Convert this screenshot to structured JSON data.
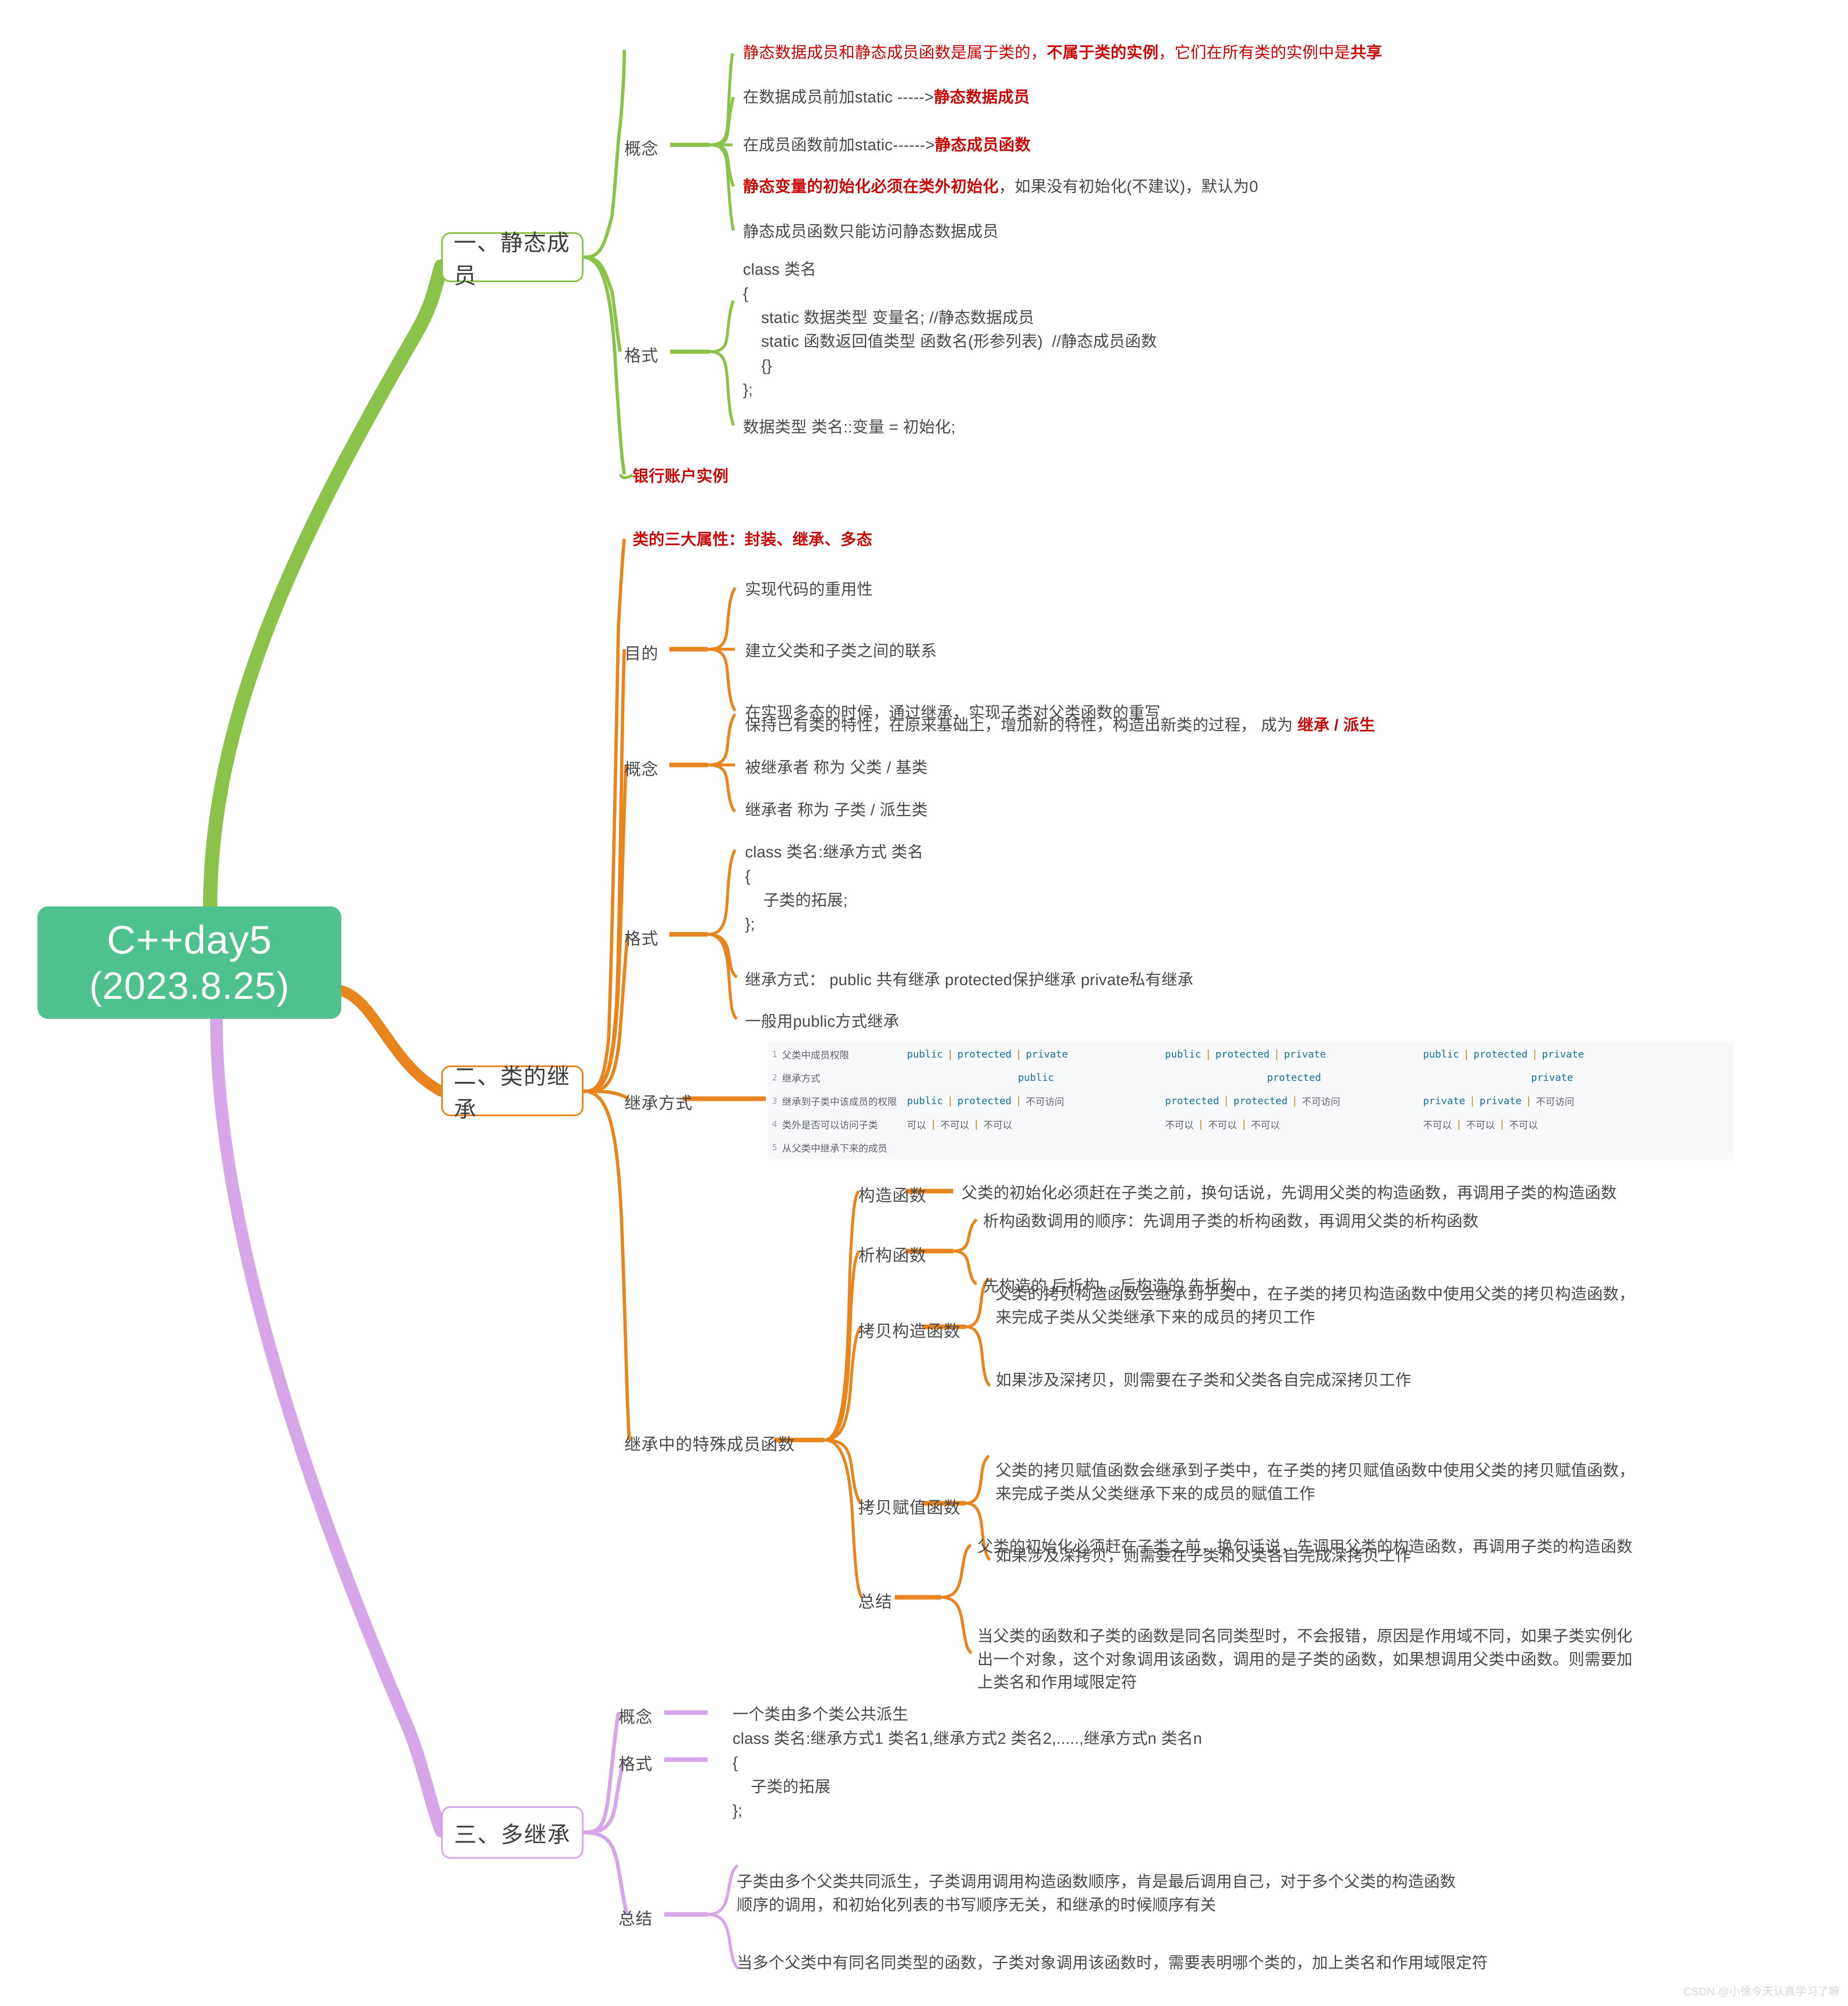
{
  "root": {
    "line1": "C++day5",
    "line2": "(2023.8.25)"
  },
  "colors": {
    "root_bg": "#4ec18e",
    "branch1": "#8bc34a",
    "branch2": "#e8851e",
    "branch3": "#d6a6e8",
    "highlight_red": "#cc0000",
    "text": "#4a4a4a",
    "table_bg": "#f8f9fb",
    "table_keyword": "#1a73a7",
    "table_sep": "#c8860d"
  },
  "branches": [
    {
      "title": "一、静态成员",
      "groups": [
        {
          "label": "概念",
          "items": [
            {
              "parts": [
                {
                  "t": "静态数据成员和静态成员函数是属于类的，",
                  "s": "n"
                },
                {
                  "t": "不属于类的实例",
                  "s": "b"
                },
                {
                  "t": "，它们在所有类的实例中是",
                  "s": "n"
                },
                {
                  "t": "共享",
                  "s": "b"
                }
              ]
            },
            {
              "parts": [
                {
                  "t": "在数据成员前加static ----->",
                  "s": "n"
                },
                {
                  "t": "静态数据成员",
                  "s": "b"
                }
              ]
            },
            {
              "parts": [
                {
                  "t": "在成员函数前加static------>",
                  "s": "n"
                },
                {
                  "t": "静态成员函数",
                  "s": "b"
                }
              ]
            },
            {
              "parts": [
                {
                  "t": "静态变量的初始化必须在类外初始化",
                  "s": "b"
                },
                {
                  "t": "，如果没有初始化(不建议)，默认为0",
                  "s": "n"
                }
              ]
            },
            {
              "parts": [
                {
                  "t": "静态成员函数只能访问静态数据成员",
                  "s": "n"
                }
              ]
            }
          ]
        },
        {
          "label": "格式",
          "items": [
            {
              "code": "class 类名\n{\n    static 数据类型 变量名; //静态数据成员\n    static 函数返回值类型 函数名(形参列表)  //静态成员函数\n    {}\n};"
            },
            {
              "parts": [
                {
                  "t": "数据类型 类名::变量 = 初始化;",
                  "s": "n"
                }
              ]
            }
          ]
        }
      ],
      "standalone": [
        {
          "parts": [
            {
              "t": "银行账户实例",
              "s": "b"
            }
          ]
        }
      ]
    },
    {
      "title": "二、类的继承",
      "standalone_top": [
        {
          "parts": [
            {
              "t": "类的三大属性：封装、继承、多态",
              "s": "b"
            }
          ]
        }
      ],
      "groups": [
        {
          "label": "目的",
          "items": [
            {
              "parts": [
                {
                  "t": "实现代码的重用性",
                  "s": "n"
                }
              ]
            },
            {
              "parts": [
                {
                  "t": "建立父类和子类之间的联系",
                  "s": "n"
                }
              ]
            },
            {
              "parts": [
                {
                  "t": "在实现多态的时候，通过继承，实现子类对父类函数的重写",
                  "s": "n"
                }
              ]
            }
          ]
        },
        {
          "label": "概念",
          "items": [
            {
              "parts": [
                {
                  "t": "保持已有类的特性，在原来基础上，增加新的特性，构造出新类的过程， 成为 ",
                  "s": "n"
                },
                {
                  "t": "继承 / 派生",
                  "s": "b"
                }
              ]
            },
            {
              "parts": [
                {
                  "t": "被继承者 称为  父类 / 基类",
                  "s": "n"
                }
              ]
            },
            {
              "parts": [
                {
                  "t": "继承者 称为 子类 / 派生类",
                  "s": "n"
                }
              ]
            }
          ]
        },
        {
          "label": "格式",
          "items": [
            {
              "code": "class 类名:继承方式 类名\n{\n    子类的拓展;\n};"
            },
            {
              "parts": [
                {
                  "t": "继承方式：  public 共有继承 protected保护继承 private私有继承",
                  "s": "n"
                }
              ]
            },
            {
              "parts": [
                {
                  "t": "一般用public方式继承",
                  "s": "n"
                }
              ]
            }
          ]
        },
        {
          "label": "继承方式",
          "table_ref": true
        },
        {
          "label": "继承中的特殊成员函数",
          "subgroups": [
            {
              "label": "构造函数",
              "items": [
                {
                  "parts": [
                    {
                      "t": "父类的初始化必须赶在子类之前，换句话说，先调用父类的构造函数，再调用子类的构造函数",
                      "s": "n"
                    }
                  ]
                }
              ]
            },
            {
              "label": "析构函数",
              "items": [
                {
                  "parts": [
                    {
                      "t": "析构函数调用的顺序：先调用子类的析构函数，再调用父类的析构函数",
                      "s": "n"
                    }
                  ]
                },
                {
                  "parts": [
                    {
                      "t": "先构造的 后析构。 后构造的 先析构",
                      "s": "n"
                    }
                  ]
                }
              ]
            },
            {
              "label": "拷贝构造函数",
              "items": [
                {
                  "parts": [
                    {
                      "t": "父类的拷贝构造函数会继承到子类中，在子类的拷贝构造函数中使用父类的拷贝构造函数，\n来完成子类从父类继承下来的成员的拷贝工作",
                      "s": "n"
                    }
                  ]
                },
                {
                  "parts": [
                    {
                      "t": "如果涉及深拷贝，则需要在子类和父类各自完成深拷贝工作",
                      "s": "n"
                    }
                  ]
                }
              ]
            },
            {
              "label": "拷贝赋值函数",
              "items": [
                {
                  "parts": [
                    {
                      "t": "父类的拷贝赋值函数会继承到子类中，在子类的拷贝赋值函数中使用父类的拷贝赋值函数，\n来完成子类从父类继承下来的成员的赋值工作",
                      "s": "n"
                    }
                  ]
                },
                {
                  "parts": [
                    {
                      "t": "如果涉及深拷贝，则需要在子类和父类各自完成深拷贝工作",
                      "s": "n"
                    }
                  ]
                }
              ]
            },
            {
              "label": "总结",
              "items": [
                {
                  "parts": [
                    {
                      "t": "父类的初始化必须赶在子类之前，换句话说，先调用父类的构造函数，再调用子类的构造函数",
                      "s": "n"
                    }
                  ]
                },
                {
                  "parts": [
                    {
                      "t": "当父类的函数和子类的函数是同名同类型时，不会报错，原因是作用域不同，如果子类实例化\n出一个对象，这个对象调用该函数，调用的是子类的函数，如果想调用父类中函数。则需要加\n上类名和作用域限定符",
                      "s": "n"
                    }
                  ]
                }
              ]
            }
          ]
        }
      ]
    },
    {
      "title": "三、多继承",
      "groups": [
        {
          "label": "概念",
          "items": [
            {
              "parts": [
                {
                  "t": "一个类由多个类公共派生",
                  "s": "n"
                }
              ]
            }
          ]
        },
        {
          "label": "格式",
          "items": [
            {
              "code": "class 类名:继承方式1 类名1,继承方式2 类名2,.....,继承方式n 类名n\n{\n    子类的拓展\n};"
            }
          ]
        },
        {
          "label": "总结",
          "items": [
            {
              "parts": [
                {
                  "t": "子类由多个父类共同派生，子类调用调用构造函数顺序，肯是最后调用自己，对于多个父类的构造函数\n顺序的调用，和初始化列表的书写顺序无关，和继承的时候顺序有关",
                  "s": "n"
                }
              ]
            },
            {
              "parts": [
                {
                  "t": "当多个父类中有同名同类型的函数，子类对象调用该函数时，需要表明哪个类的，加上类名和作用域限定符",
                  "s": "n"
                }
              ]
            }
          ]
        }
      ]
    }
  ],
  "permission_table": {
    "rows": [
      {
        "num": "1",
        "label": "父类中成员权限",
        "groups": [
          {
            "cells": [
              "public",
              "protected",
              "private"
            ],
            "center": false
          },
          {
            "cells": [
              "public",
              "protected",
              "private"
            ],
            "center": false
          },
          {
            "cells": [
              "public",
              "protected",
              "private"
            ],
            "center": false
          }
        ]
      },
      {
        "num": "2",
        "label": "继承方式",
        "groups": [
          {
            "cells": [
              "public"
            ],
            "center": true
          },
          {
            "cells": [
              "protected"
            ],
            "center": true
          },
          {
            "cells": [
              "private"
            ],
            "center": true
          }
        ]
      },
      {
        "num": "3",
        "label": "继承到子类中该成员的权限",
        "groups": [
          {
            "cells": [
              "public",
              "protected",
              "不可访问"
            ],
            "center": false
          },
          {
            "cells": [
              "protected",
              "protected",
              "不可访问"
            ],
            "center": false
          },
          {
            "cells": [
              "private",
              "private",
              "不可访问"
            ],
            "center": false
          }
        ]
      },
      {
        "num": "4",
        "label": "类外是否可以访问子类",
        "groups": [
          {
            "cells": [
              "可以",
              "不可以",
              "不可以"
            ],
            "center": false
          },
          {
            "cells": [
              "不可以",
              "不可以",
              "不可以"
            ],
            "center": false
          },
          {
            "cells": [
              "不可以",
              "不可以",
              "不可以"
            ],
            "center": false
          }
        ]
      },
      {
        "num": "5",
        "label": "从父类中继承下来的成员",
        "groups": [
          {
            "cells": [],
            "center": false
          },
          {
            "cells": [],
            "center": false
          },
          {
            "cells": [],
            "center": false
          }
        ]
      }
    ]
  },
  "watermark": "CSDN @小徐今天认真学习了嘛"
}
